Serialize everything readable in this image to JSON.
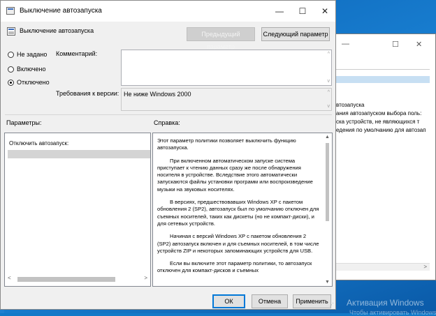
{
  "dialog": {
    "title": "Выключение автозапуска",
    "header_title": "Выключение автозапуска",
    "prev_setting_label": "Предыдущий параметр",
    "next_setting_label": "Следующий параметр",
    "radios": [
      {
        "label": "Не задано",
        "checked": false
      },
      {
        "label": "Включено",
        "checked": false
      },
      {
        "label": "Отключено",
        "checked": true
      }
    ],
    "comment_label": "Комментарий:",
    "comment_value": "",
    "requirements_label": "Требования к версии:",
    "requirements_value": "Не ниже Windows 2000",
    "options_label": "Параметры:",
    "help_label": "Справка:",
    "options_panel": {
      "setting_label": "Отключить автозапуск:"
    },
    "help_paragraphs": [
      "Этот параметр политики позволяет выключить функцию автозапуска.",
      "При включенном автоматическом запуске система приступает к чтению данных сразу же после обнаружения носителя в устройстве. Вследствие этого автоматически запускаются файлы установки программ или воспроизведение музыки на звуковых носителях.",
      "В версиях, предшествовавших Windows XP с пакетом обновления 2 (SP2), автозапуск был по умолчанию отключен для съемных носителей, таких как дискеты (но не компакт-диски), и для сетевых устройств.",
      "Начиная с версий Windows XP с пакетом обновления 2 (SP2) автозапуск включен и для съемных носителей, в том числе устройств ZIP и некоторых запоминающих устройств для USB.",
      "Если вы включите этот параметр политики, то автозапуск отключен для компакт-дисков и съемных"
    ],
    "ok_label": "ОК",
    "cancel_label": "Отмена",
    "apply_label": "Применить",
    "minimize_glyph": "—",
    "maximize_glyph": "☐",
    "close_glyph": "✕"
  },
  "background_window": {
    "minimize_glyph": "—",
    "maximize_glyph": "☐",
    "close_glyph": "✕",
    "heading": "втозапуска",
    "lines": [
      "ания автозапуском выбора поль:",
      "ска устройств, не являющихся т",
      "едения по умолчанию для автозап"
    ]
  },
  "watermark": {
    "line1": "Активация Windows",
    "line2": "Чтобы активировать Windows, перейдите"
  },
  "colors": {
    "desktop": "#1379c8",
    "dialog_bg": "#f0f0f0",
    "accent": "#0078d7"
  }
}
